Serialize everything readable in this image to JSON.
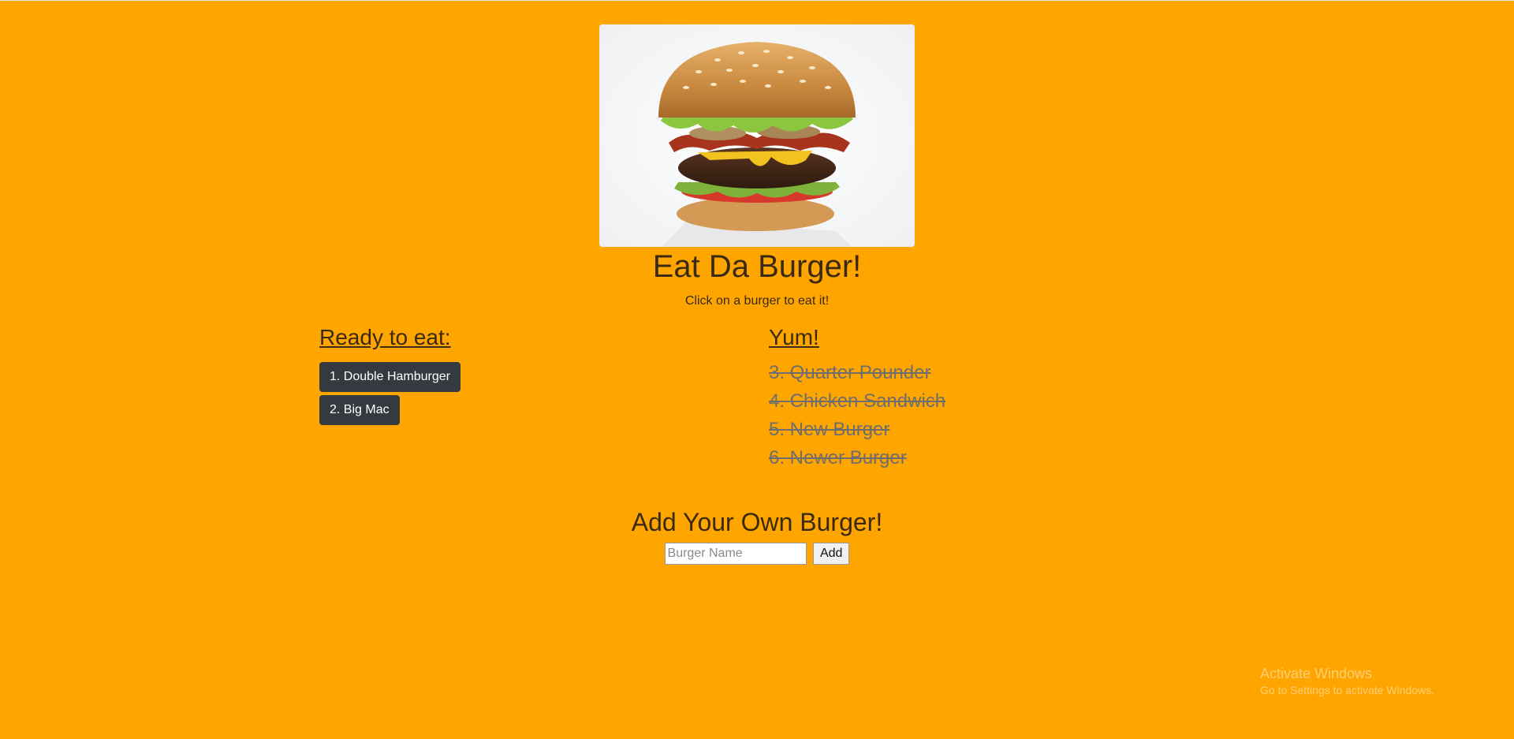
{
  "header": {
    "title": "Eat Da Burger!",
    "subtitle": "Click on a burger to eat it!"
  },
  "ready": {
    "heading": "Ready to eat:",
    "burgers": [
      "1. Double Hamburger",
      "2. Big Mac"
    ]
  },
  "eaten": {
    "heading": "Yum!",
    "burgers": [
      "3. Quarter Pounder",
      "4. Chicken Sandwich",
      "5. New Burger",
      "6. Newer Burger"
    ]
  },
  "add": {
    "heading": "Add Your Own Burger!",
    "input_placeholder": "Burger Name",
    "input_value": "",
    "button_label": "Add"
  },
  "watermark": {
    "line1": "Activate Windows",
    "line2": "Go to Settings to activate Windows."
  },
  "colors": {
    "background": "#ffa500",
    "button_dark": "#343a40",
    "eaten_text": "#6e6e6e"
  }
}
